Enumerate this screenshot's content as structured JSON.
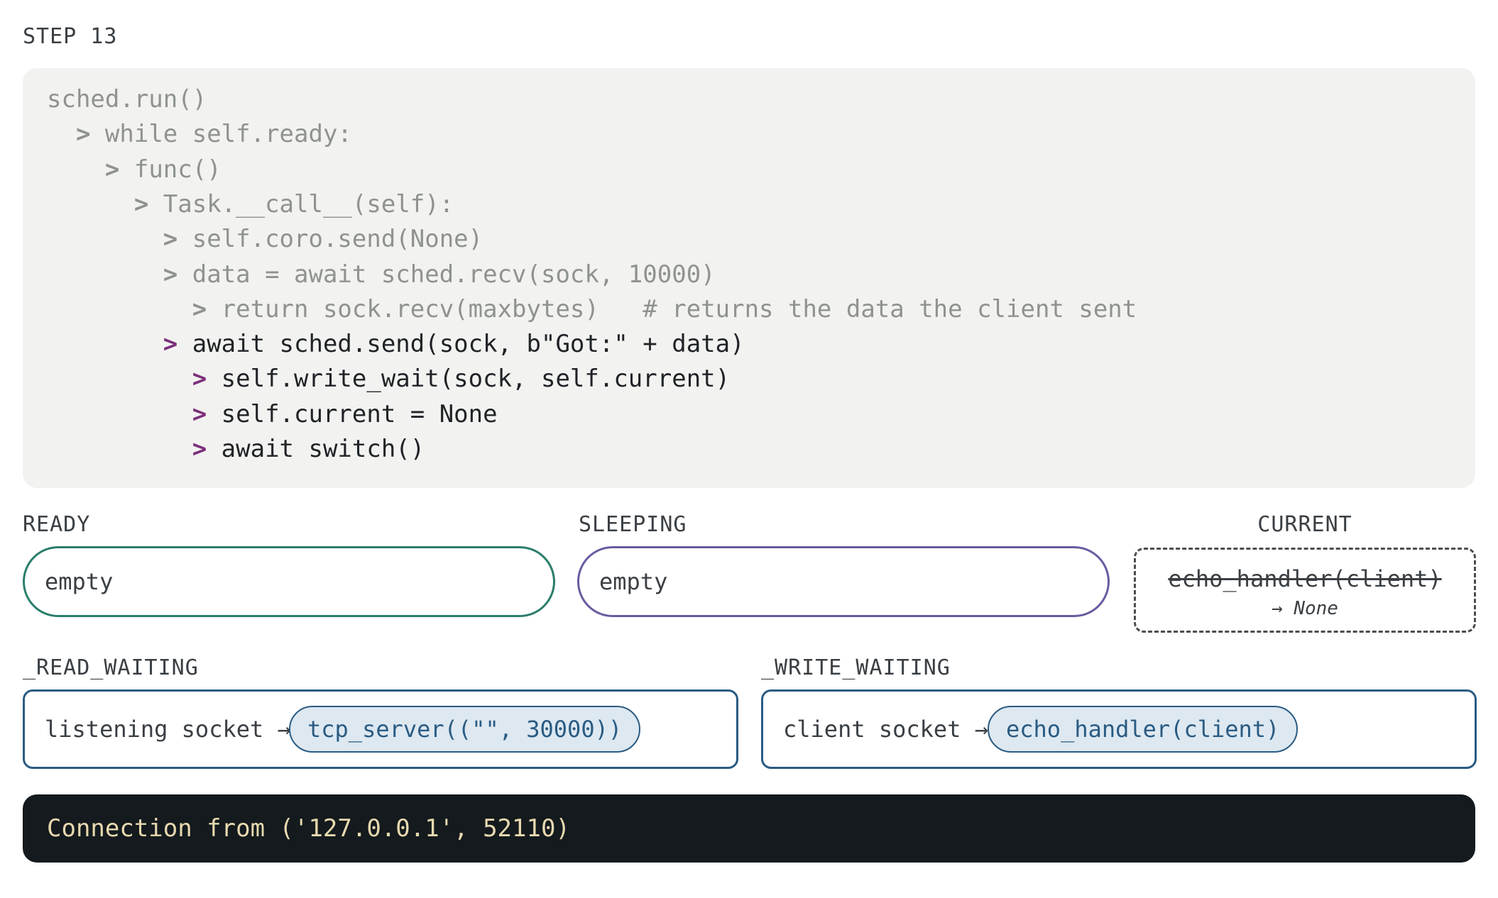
{
  "step_label": "STEP 13",
  "code": {
    "lines": [
      {
        "indent": "",
        "arrow": "",
        "text": "sched.run()",
        "state": "dim"
      },
      {
        "indent": "  ",
        "arrow": "> ",
        "text": "while self.ready:",
        "state": "dim"
      },
      {
        "indent": "    ",
        "arrow": "> ",
        "text": "func()",
        "state": "dim"
      },
      {
        "indent": "      ",
        "arrow": "> ",
        "text": "Task.__call__(self):",
        "state": "dim"
      },
      {
        "indent": "        ",
        "arrow": "> ",
        "text": "self.coro.send(None)",
        "state": "dim"
      },
      {
        "indent": "        ",
        "arrow": "> ",
        "text": "data = await sched.recv(sock, 10000)",
        "state": "dim"
      },
      {
        "indent": "          ",
        "arrow": "> ",
        "text": "return sock.recv(maxbytes)   # returns the data the client sent",
        "state": "dim"
      },
      {
        "indent": "        ",
        "arrow": "> ",
        "text": "await sched.send(sock, b\"Got:\" + data)",
        "state": "active"
      },
      {
        "indent": "          ",
        "arrow": "> ",
        "text": "self.write_wait(sock, self.current)",
        "state": "active"
      },
      {
        "indent": "          ",
        "arrow": "> ",
        "text": "self.current = None",
        "state": "active"
      },
      {
        "indent": "          ",
        "arrow": "> ",
        "text": "await switch()",
        "state": "active"
      }
    ]
  },
  "ready": {
    "label": "READY",
    "value": "empty"
  },
  "sleeping": {
    "label": "SLEEPING",
    "value": "empty"
  },
  "current": {
    "label": "CURRENT",
    "task": "echo_handler(client)",
    "note": "→ None"
  },
  "read_waiting": {
    "label": "_READ_WAITING",
    "key": "listening socket →",
    "task": "tcp_server((\"\", 30000))"
  },
  "write_waiting": {
    "label": "_WRITE_WAITING",
    "key": "client socket →",
    "task": "echo_handler(client)"
  },
  "terminal": {
    "output": "Connection from ('127.0.0.1', 52110)"
  },
  "colors": {
    "ready_border": "#2a7d6b",
    "sleeping_border": "#6a5aa0",
    "wait_border": "#2a5b82",
    "chip_fill": "#dde8f1",
    "active_arrow": "#7b2f7a",
    "terminal_bg": "#141a1d",
    "terminal_text": "#e8d9b0"
  }
}
